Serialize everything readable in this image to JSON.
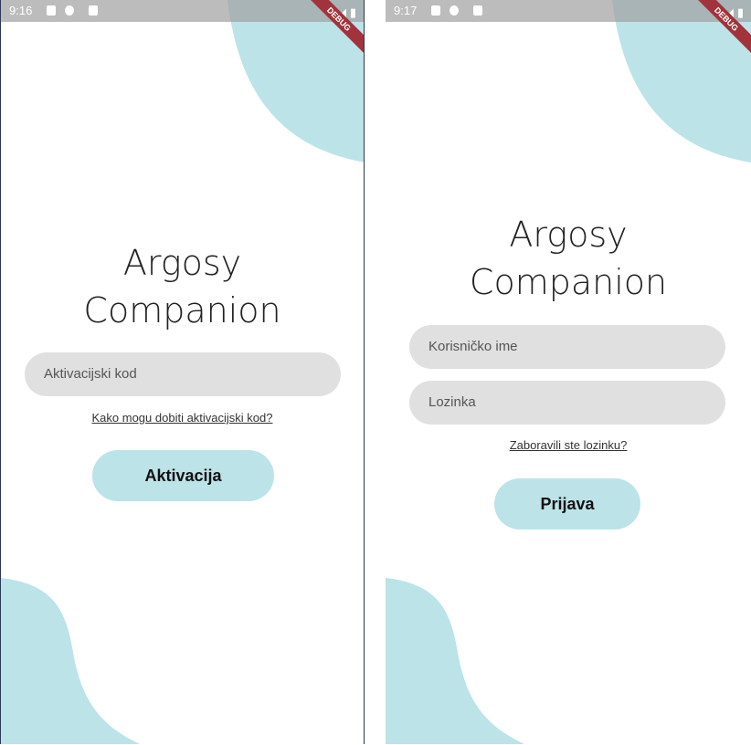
{
  "colors": {
    "accent": "#bce3e8",
    "field": "#e0e0e0"
  },
  "activation": {
    "time": "9:16",
    "debug": "DEBUG",
    "title_line1": "Argosy",
    "title_line2": "Companion",
    "code_placeholder": "Aktivacijski kod",
    "help_link": "Kako mogu dobiti aktivacijski kod?",
    "button": "Aktivacija"
  },
  "login": {
    "time": "9:17",
    "debug": "DEBUG",
    "title_line1": "Argosy",
    "title_line2": "Companion",
    "username_placeholder": "Korisničko ime",
    "password_placeholder": "Lozinka",
    "forgot_link": "Zaboravili ste lozinku?",
    "button": "Prijava"
  }
}
